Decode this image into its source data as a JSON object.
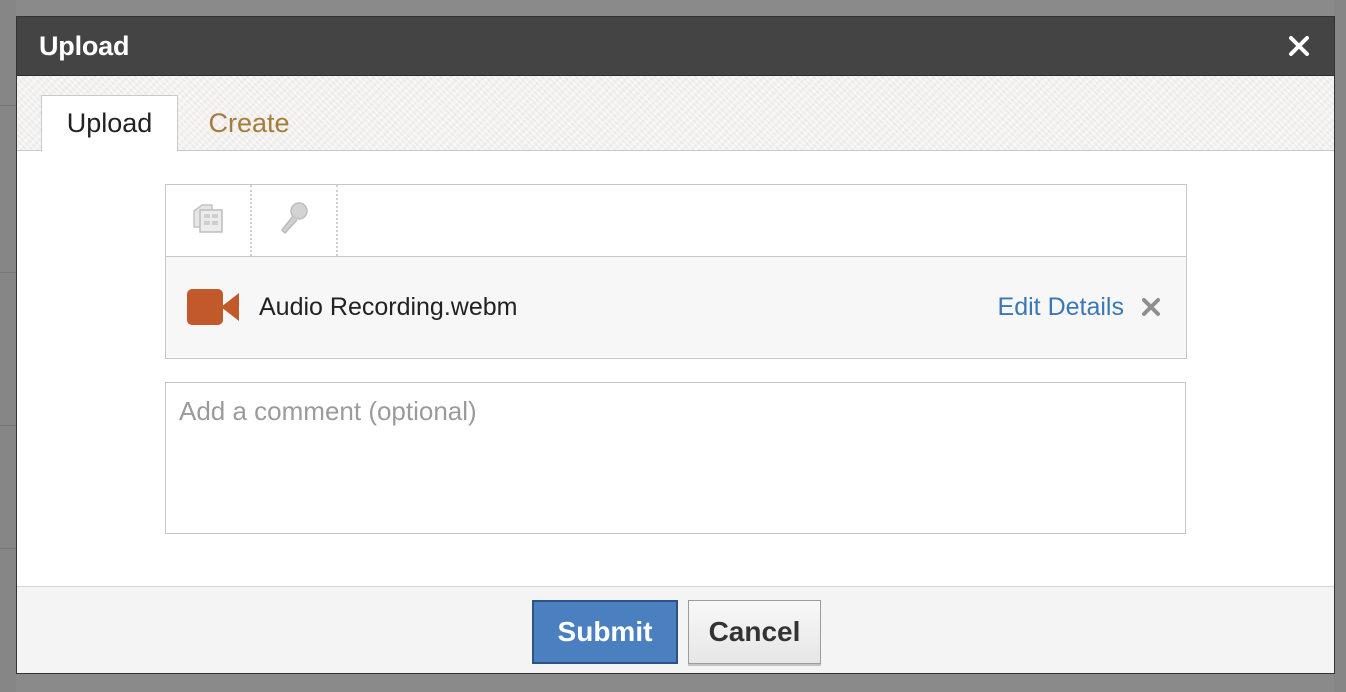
{
  "dialog": {
    "title": "Upload",
    "close_icon": "close-icon"
  },
  "tabs": [
    {
      "label": "Upload",
      "active": true
    },
    {
      "label": "Create",
      "active": false
    }
  ],
  "toolbar": {
    "tools": [
      {
        "name": "file-browser-icon"
      },
      {
        "name": "microphone-icon"
      }
    ]
  },
  "file": {
    "icon": "video-camera-icon",
    "name": "Audio Recording.webm",
    "edit_label": "Edit Details",
    "icon_color": "#c2592a"
  },
  "comment": {
    "placeholder": "Add a comment (optional)",
    "value": ""
  },
  "footer": {
    "submit_label": "Submit",
    "cancel_label": "Cancel"
  },
  "colors": {
    "titlebar": "#444444",
    "link": "#3a78b5",
    "tab_inactive": "#a57c3a",
    "submit": "#4a80bf"
  }
}
